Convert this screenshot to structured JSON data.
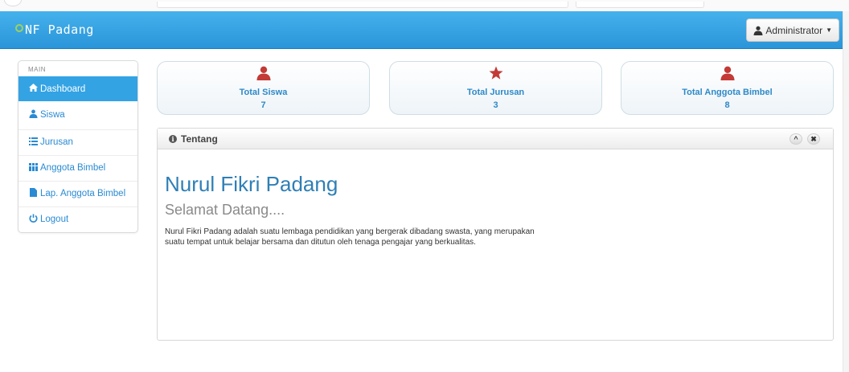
{
  "brand": {
    "name": "NF Padang"
  },
  "user_menu": {
    "label": "Administrator"
  },
  "sidebar": {
    "section_label": "MAIN",
    "items": [
      {
        "label": "Dashboard",
        "icon": "home-icon",
        "active": true
      },
      {
        "label": "Siswa",
        "icon": "user-icon"
      },
      {
        "label": "Jurusan",
        "icon": "list-icon"
      },
      {
        "label": "Anggota Bimbel",
        "icon": "grid-icon"
      },
      {
        "label": "Lap. Anggota Bimbel",
        "icon": "file-icon"
      },
      {
        "label": "Logout",
        "icon": "power-icon"
      }
    ]
  },
  "stats": [
    {
      "label": "Total Siswa",
      "value": "7",
      "icon": "user-icon"
    },
    {
      "label": "Total Jurusan",
      "value": "3",
      "icon": "star-icon"
    },
    {
      "label": "Total Anggota Bimbel",
      "value": "8",
      "icon": "user-icon"
    }
  ],
  "panel": {
    "title": "Tentang",
    "heading": "Nurul Fikri Padang",
    "subheading": "Selamat Datang....",
    "description": "Nurul Fikri Padang adalah suatu lembaga pendidikan yang bergerak dibadang swasta, yang merupakan suatu tempat untuk belajar bersama dan ditutun oleh tenaga pengajar yang berkualitas."
  },
  "colors": {
    "navbar": "#2a95d9",
    "accent": "#33a3e4",
    "stat_icon": "#c33a36",
    "heading": "#2f7fb6"
  }
}
